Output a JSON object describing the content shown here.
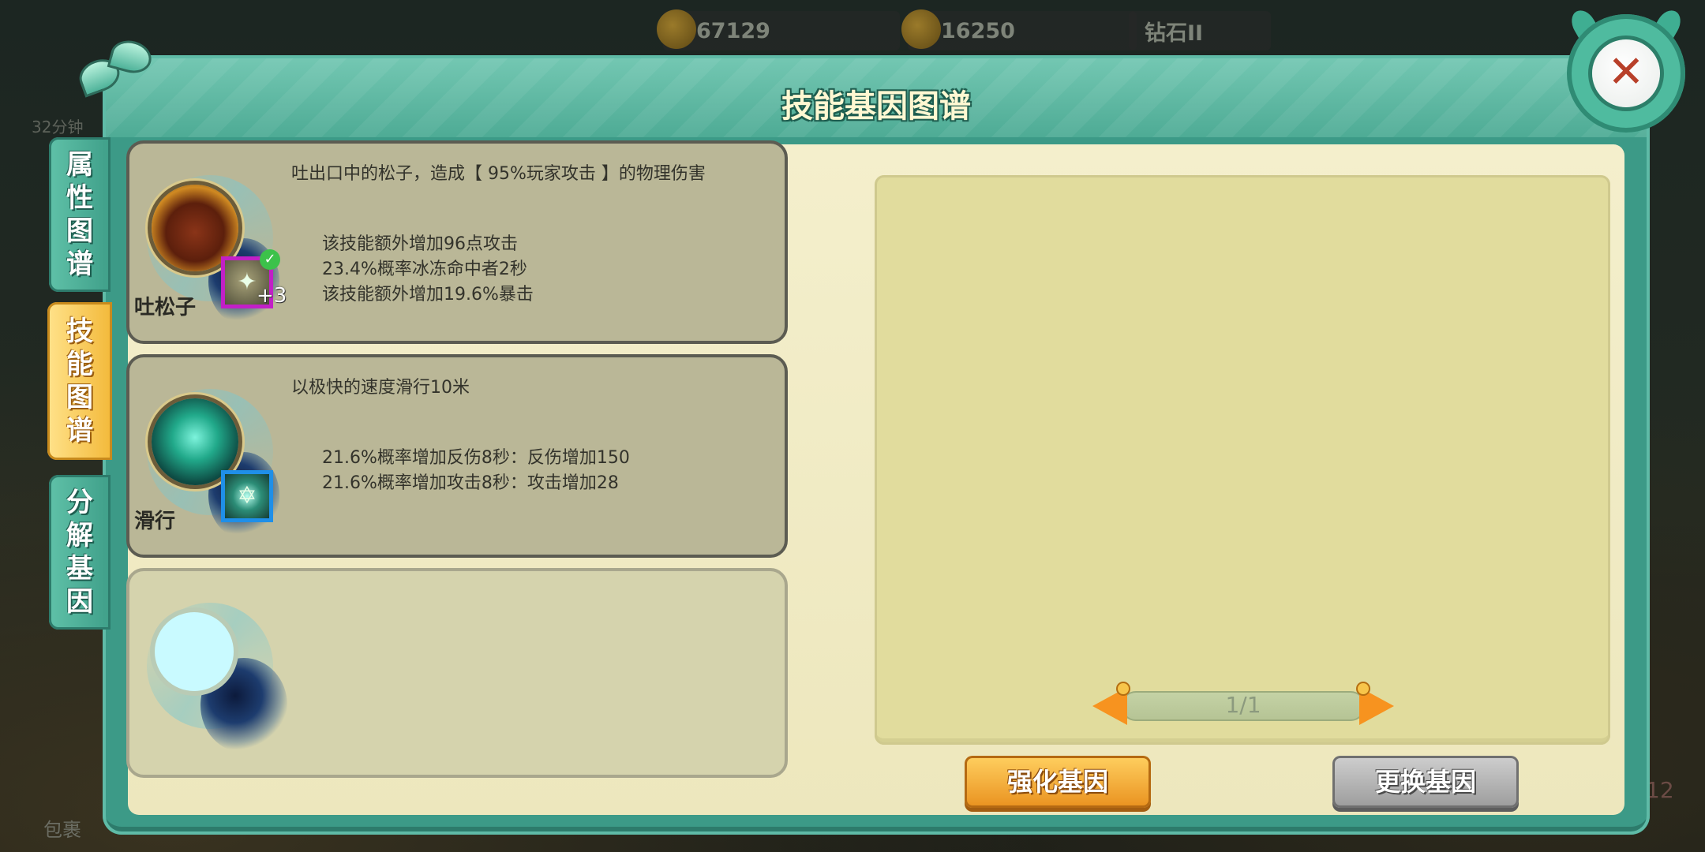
{
  "top_bar": {
    "gold": "67129",
    "gems": "16250",
    "rank": "钻石II"
  },
  "background": {
    "timer_text": "32分钟",
    "bag_label": "包裹",
    "corner_number": "12"
  },
  "panel": {
    "title": "技能基因图谱",
    "close_icon": "close-x-icon"
  },
  "tabs": [
    {
      "label": "属性图谱",
      "active": false
    },
    {
      "label": "技能图谱",
      "active": true
    },
    {
      "label": "分解基因",
      "active": false
    }
  ],
  "skills": [
    {
      "name": "吐松子",
      "icon": "pine-nut-orb-icon",
      "description": "吐出口中的松子，造成【 95%玩家攻击 】的物理伤害",
      "gene": {
        "color": "#c21fc7",
        "level": "+3",
        "equipped": true
      },
      "effects": [
        "该技能额外增加96点攻击",
        "23.4%概率冰冻命中者2秒",
        "该技能额外增加19.6%暴击"
      ]
    },
    {
      "name": "滑行",
      "icon": "glide-wings-orb-icon",
      "description": "以极快的速度滑行10米",
      "gene": {
        "color": "#1f8fe8",
        "level": "",
        "equipped": false
      },
      "effects": [
        "21.6%概率增加反伤8秒：反伤增加150",
        "21.6%概率增加攻击8秒：攻击增加28"
      ]
    },
    {
      "name": "",
      "icon": "empty-skill-slot",
      "description": "",
      "effects": []
    }
  ],
  "detail": {
    "pager": "1/1"
  },
  "buttons": {
    "enhance": "强化基因",
    "replace": "更换基因"
  },
  "colors": {
    "panel": "#3c9a87",
    "content_bg": "#f4efcc",
    "active_tab": "#f3b93a",
    "enhance_button": "#e9911f",
    "replace_button": "#9c9c9c",
    "pager_arrow": "#f7931f"
  }
}
